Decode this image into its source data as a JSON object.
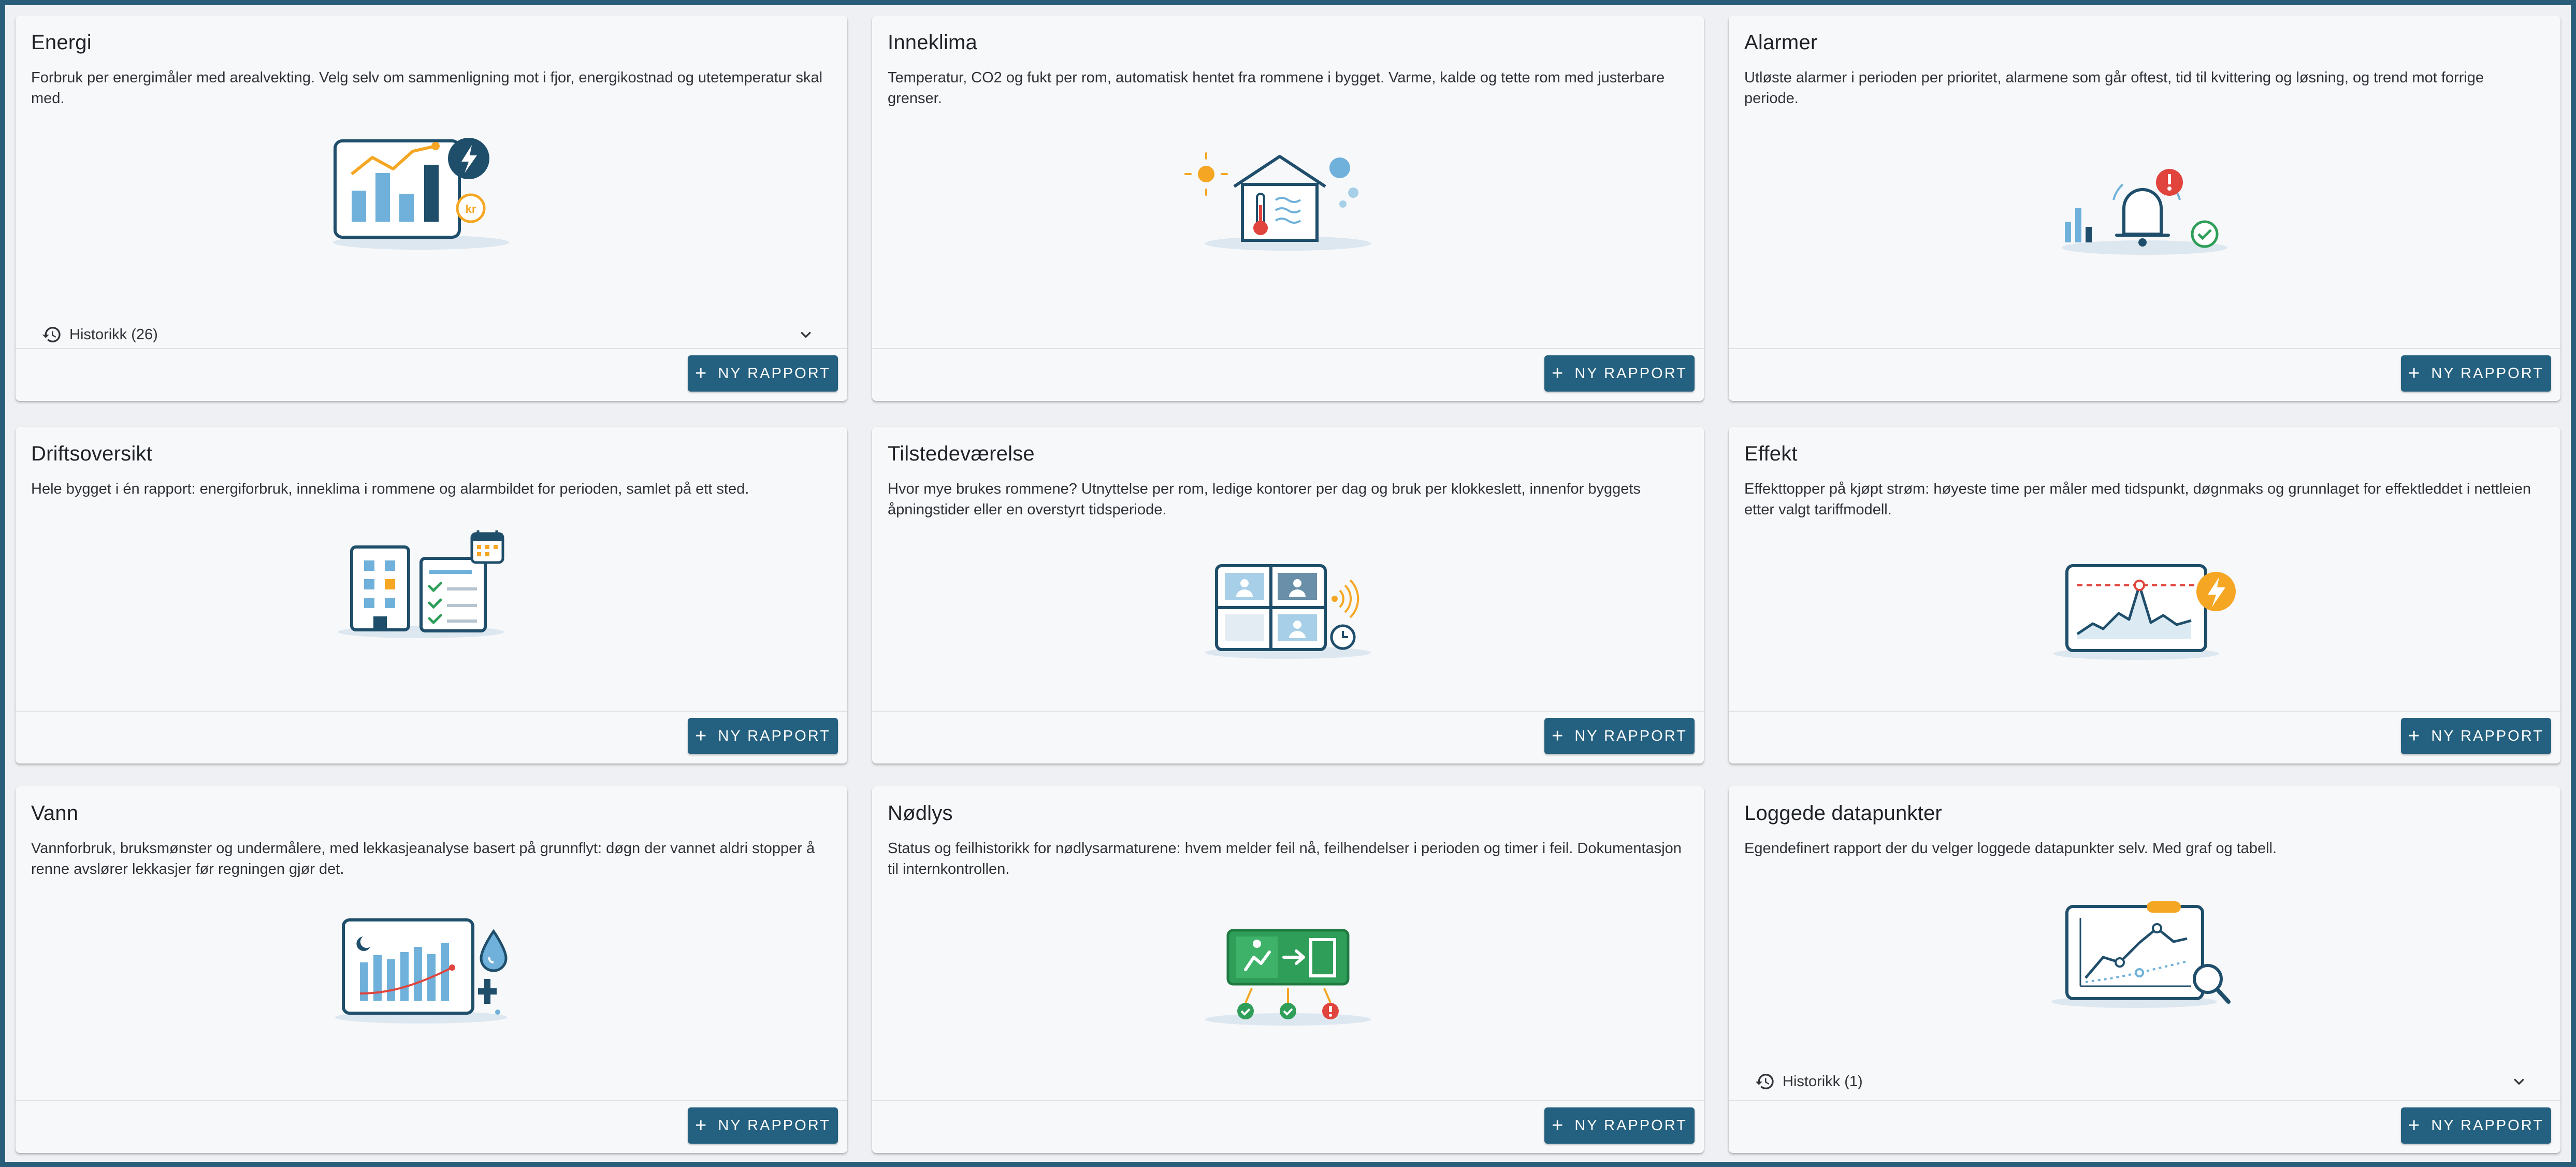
{
  "cards": [
    {
      "title": "Energi",
      "description": "Forbruk per energimåler med arealvekting. Velg selv om sammenligning mot i fjor, energikostnad og utetemperatur skal med.",
      "history_label": "Historikk (26)",
      "button_label": "NY RAPPORT",
      "icon": "energy-chart-icon",
      "badge_text": "kr"
    },
    {
      "title": "Inneklima",
      "description": "Temperatur, CO2 og fukt per rom, automatisk hentet fra rommene i bygget. Varme, kalde og tette rom med justerbare grenser.",
      "button_label": "NY RAPPORT",
      "icon": "house-climate-icon"
    },
    {
      "title": "Alarmer",
      "description": "Utløste alarmer i perioden per prioritet, alarmene som går oftest, tid til kvittering og løsning, og trend mot forrige periode.",
      "button_label": "NY RAPPORT",
      "icon": "alarm-bell-icon"
    },
    {
      "title": "Driftsoversikt",
      "description": "Hele bygget i én rapport: energiforbruk, inneklima i rommene og alarmbildet for perioden, samlet på ett sted.",
      "button_label": "NY RAPPORT",
      "icon": "building-checklist-icon"
    },
    {
      "title": "Tilstedeværelse",
      "description": "Hvor mye brukes rommene? Utnyttelse per rom, ledige kontorer per dag og bruk per klokkeslett, innenfor byggets åpningstider eller en overstyrt tidsperiode.",
      "button_label": "NY RAPPORT",
      "icon": "occupancy-rooms-icon"
    },
    {
      "title": "Effekt",
      "description": "Effekttopper på kjøpt strøm: høyeste time per måler med tidspunkt, døgnmaks og grunnlaget for effektleddet i nettleien etter valgt tariffmodell.",
      "button_label": "NY RAPPORT",
      "icon": "power-peak-icon"
    },
    {
      "title": "Vann",
      "description": "Vannforbruk, bruksmønster og undermålere, med lekkasjeanalyse basert på grunnflyt: døgn der vannet aldri stopper å renne avslører lekkasjer før regningen gjør det.",
      "button_label": "NY RAPPORT",
      "icon": "water-usage-icon"
    },
    {
      "title": "Nødlys",
      "description": "Status og feilhistorikk for nødlysarmaturene: hvem melder feil nå, feilhendelser i perioden og timer i feil. Dokumentasjon til internkontrollen.",
      "button_label": "NY RAPPORT",
      "icon": "emergency-exit-sign-icon"
    },
    {
      "title": "Loggede datapunkter",
      "description": "Egendefinert rapport der du velger loggede datapunkter selv. Med graf og tabell.",
      "history_label": "Historikk (1)",
      "button_label": "NY RAPPORT",
      "icon": "logged-datapoints-graph-icon"
    }
  ],
  "colors": {
    "accent": "#24607f",
    "frame": "#2a5d7a",
    "illustration_blue": "#1f4e6b",
    "light_blue": "#6fb1da",
    "orange": "#f5a623",
    "red": "#e0443c",
    "green": "#2e9e58"
  }
}
